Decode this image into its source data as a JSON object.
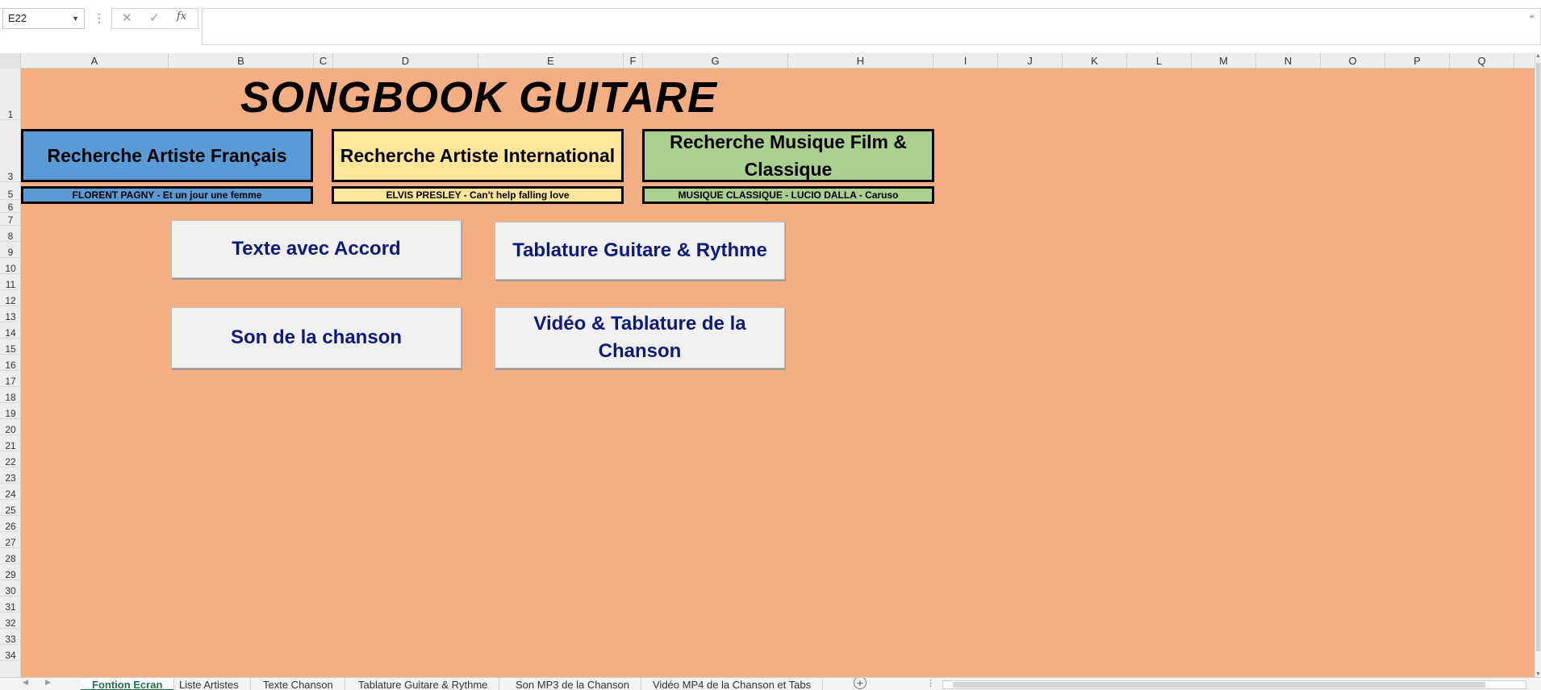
{
  "formula_bar": {
    "name_box": "E22",
    "fx": "fx",
    "dots": "⋮",
    "cancel": "✕",
    "enter": "✓",
    "value": ""
  },
  "grid": {
    "columns": [
      "A",
      "B",
      "C",
      "D",
      "E",
      "F",
      "G",
      "H",
      "I",
      "J",
      "K",
      "L",
      "M",
      "N",
      "O",
      "P",
      "Q"
    ],
    "rows": [
      "1",
      "3",
      "5",
      "6",
      "7",
      "8",
      "9",
      "10",
      "11",
      "12",
      "13",
      "14",
      "15",
      "16",
      "17",
      "18",
      "19",
      "20",
      "21",
      "22",
      "23",
      "24",
      "25",
      "26",
      "27",
      "28",
      "29",
      "30",
      "31",
      "32",
      "33",
      "34"
    ],
    "sheet_color": "#f4ae84"
  },
  "sheet": {
    "title": "SONGBOOK GUITARE",
    "categories": {
      "french": "Recherche Artiste Français",
      "international": "Recherche Artiste International",
      "film_classic": "Recherche Musique Film & Classique"
    },
    "songs": {
      "french": "FLORENT PAGNY - Et un jour une femme",
      "international": "ELVIS PRESLEY - Can't help falling love",
      "film_classic": "MUSIQUE CLASSIQUE - LUCIO DALLA - Caruso"
    },
    "buttons": {
      "texte": "Texte avec Accord",
      "tablature": "Tablature Guitare & Rythme",
      "son": "Son de la chanson",
      "video": "Vidéo & Tablature de la Chanson"
    }
  },
  "tabs": {
    "items": [
      {
        "label": "Fontion Ecran",
        "active": true
      },
      {
        "label": "Liste Artistes",
        "active": false
      },
      {
        "label": "Texte Chanson",
        "active": false
      },
      {
        "label": "Tablature Guitare & Rythme",
        "active": false
      },
      {
        "label": "Son MP3 de la Chanson",
        "active": false
      },
      {
        "label": "Vidéo MP4 de la Chanson et Tabs",
        "active": false
      }
    ],
    "add_label": "+",
    "prev": "◀",
    "next": "▶",
    "dots": "⋮"
  }
}
